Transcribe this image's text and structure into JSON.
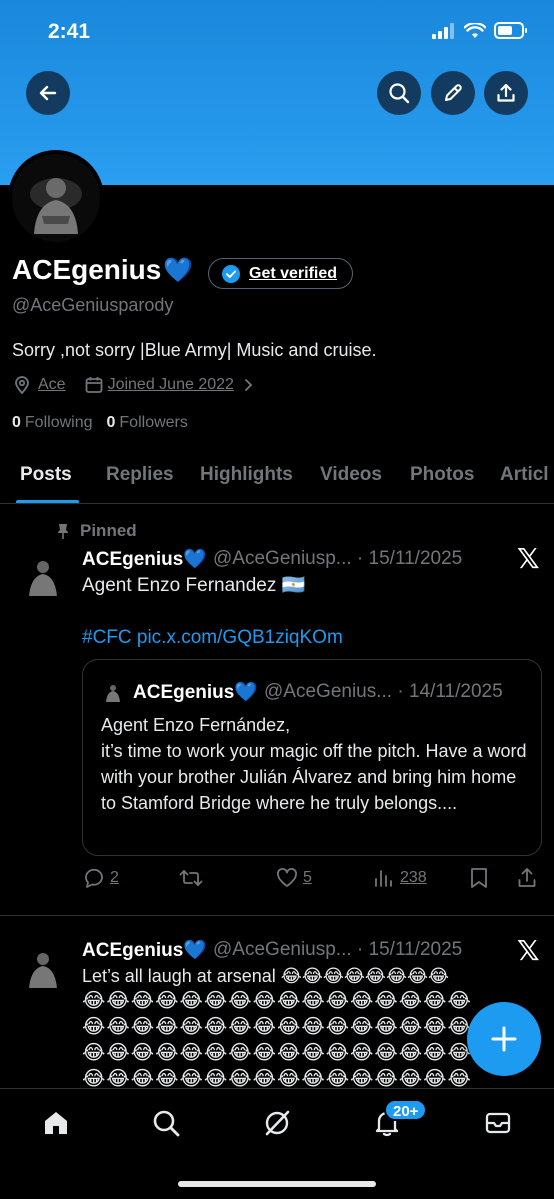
{
  "status_bar": {
    "time": "2:41"
  },
  "profile": {
    "name": "ACEgenius",
    "name_emoji": "💙",
    "verify_label": "Get verified",
    "handle": "@AceGeniusparody",
    "bio": "Sorry ,not sorry |Blue Army| Music and cruise.",
    "location": "Ace",
    "joined": "Joined June 2022",
    "following_count": "0",
    "following_label": "Following",
    "followers_count": "0",
    "followers_label": "Followers"
  },
  "tabs": [
    "Posts",
    "Replies",
    "Highlights",
    "Videos",
    "Photos",
    "Articl"
  ],
  "posts": [
    {
      "pinned_label": "Pinned",
      "name": "ACEgenius💙",
      "meta": "@AceGeniusp... · 15/11/2025",
      "text": "Agent Enzo Fernandez 🇦🇷",
      "links": "#CFC pic.x.com/GQB1ziqKOm",
      "quote": {
        "name": "ACEgenius💙",
        "meta": "@AceGenius... · 14/11/2025",
        "text": "Agent Enzo Fernández,\nit’s time to work your magic off the pitch. Have a word with your brother Julián Álvarez and bring him home to Stamford Bridge where he truly belongs...."
      },
      "replies": "2",
      "likes": "5",
      "views": "238"
    },
    {
      "name": "ACEgenius💙",
      "meta": "@AceGeniusp... · 15/11/2025",
      "text": "Let’s all laugh at arsenal 😂😂😂😂😂😂😂😂",
      "emoji_rows": [
        "😂😂😂😂😂😂😂😂😂😂😂😂😂😂😂😂",
        "😂😂😂😂😂😂😂😂😂😂😂😂😂😂😂😂",
        "😂😂😂😂😂😂😂😂😂😂😂😂😂😂😂😂",
        "😂😂😂😂😂😂😂😂😂😂😂😂😂😂😂😂"
      ]
    }
  ],
  "nav": {
    "notifications_badge": "20+"
  },
  "colors": {
    "accent": "#1d9bf0",
    "banner": "#1a88dc",
    "muted": "#71767b"
  }
}
